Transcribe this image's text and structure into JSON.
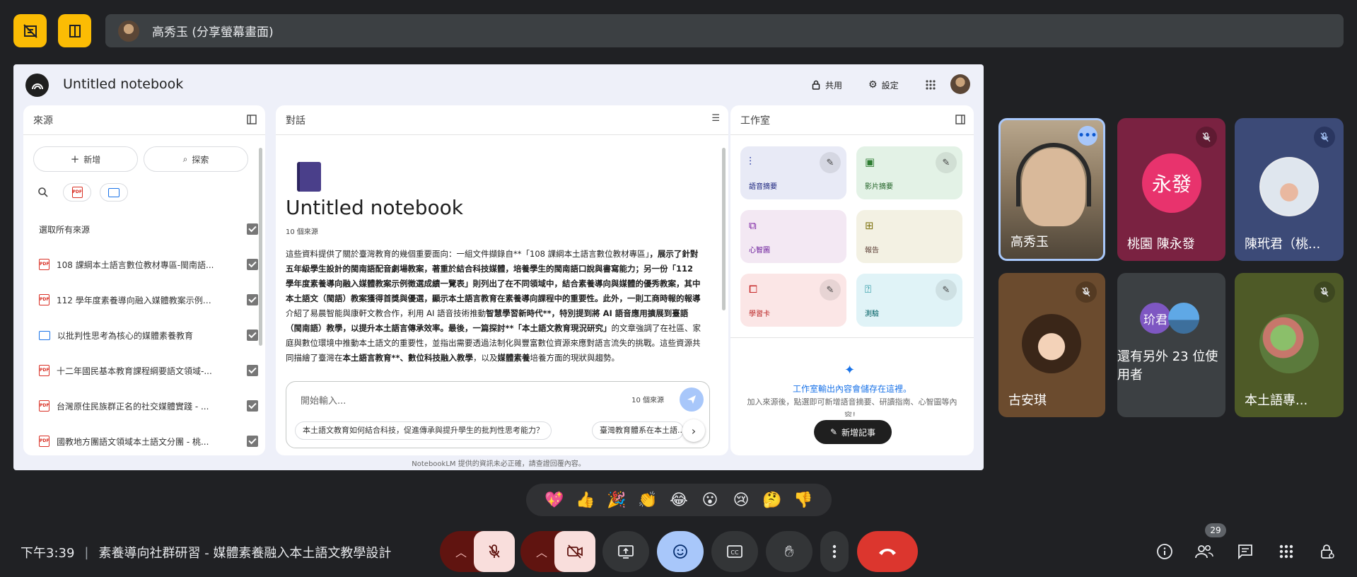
{
  "meet": {
    "presenter_label": "高秀玉 (分享螢幕畫面)",
    "time": "下午3:39",
    "meeting_title": "素養導向社群研習 - 媒體素養融入本土語文教學設計",
    "people_count": "29",
    "others_text": "還有另外 23 位使用者",
    "others_avatar_text": "玠君",
    "participants": [
      {
        "name": "高秀玉"
      },
      {
        "name": "桃園 陳永發",
        "avatar_text": "永發"
      },
      {
        "name": "陳玳君（桃..."
      },
      {
        "name": "古安琪"
      },
      {
        "name": "本土語專..."
      }
    ],
    "reactions": [
      "💖",
      "👍",
      "🎉",
      "👏",
      "😂",
      "😮",
      "😢",
      "🤔",
      "👎"
    ]
  },
  "notebook": {
    "title": "Untitled notebook",
    "share_label": "共用",
    "settings_label": "設定",
    "sources": {
      "header": "來源",
      "add_label": "新增",
      "explore_label": "探索",
      "select_all": "選取所有來源",
      "items": [
        {
          "type": "pdf",
          "label": "108 課綱本土語言數位教材專區-閩南語..."
        },
        {
          "type": "pdf",
          "label": "112 學年度素養導向融入媒體教案示例徵..."
        },
        {
          "type": "doc",
          "label": "以批判性思考為核心的媒體素養教育"
        },
        {
          "type": "pdf",
          "label": "十二年國民基本教育課程綱要語文領域-..."
        },
        {
          "type": "pdf",
          "label": "台灣原住民族群正名的社交媒體實踐 - ..."
        },
        {
          "type": "pdf",
          "label": "國教地方團語文領域本土語文分團 - 桃..."
        }
      ]
    },
    "chat": {
      "header": "對話",
      "notebook_title": "Untitled notebook",
      "source_count": "10 個來源",
      "summary_1": "這些資料提供了關於臺灣教育的幾個重要面向：一組文件擷錄自**「108 課綱本土語言數位教材專區」",
      "summary_2": "，展示了針對五年級學生設計的閩南語配音劇場教案，著重於結合科技媒體，培養學生的閩南語口說與書寫能力；另一份「112 學年度素養導向融入媒體教案示例徵選成績一覽表」則列出了在不同領域中，結合素養導向與媒體的優秀教案，其中本土語文（閩語）教案獲得首獎與優選，顯示本土語言教育在素養導向課程中的重要性。此外，一則工商時報的報導",
      "summary_3": "介紹了易晨智能與康軒文教合作，利用 AI 語音技術推動",
      "summary_4": "智慧學習新時代**，特別提到將 AI 語音應用擴展到臺語（閩南語）教學，以提升本土語言傳承效率。最後，一篇探討**「本土語文教育現況研究」",
      "summary_5": "的文章強調了在社區、家庭與數位環境中推動本土語文的重要性，並指出需要透過法制化與豐富數位資源來應對語言流失的挑戰。這些資源共同描繪了臺灣在",
      "summary_6": "本土語言教育**、數位科技融入教學",
      "summary_7": "，以及",
      "summary_8": "媒體素養",
      "summary_9": "培養方面的現狀與趨勢。",
      "input_placeholder": "開始輸入...",
      "input_source_count": "10 個來源",
      "suggestion_1": "本土語文教育如何結合科技，促進傳承與提升學生的批判性思考能力？",
      "suggestion_2": "臺灣教育體系在本土語..."
    },
    "studio": {
      "header": "工作室",
      "cards": [
        "語音摘要",
        "影片摘要",
        "心智圖",
        "報告",
        "學習卡",
        "測驗"
      ],
      "empty_title": "工作室輸出內容會儲存在這裡。",
      "empty_desc": "加入來源後，點選即可新增語音摘要、研讀指南、心智圖等內容！",
      "add_note": "新增記事"
    },
    "footer_note": "NotebookLM 提供的資訊未必正確，請查證回覆內容。"
  }
}
